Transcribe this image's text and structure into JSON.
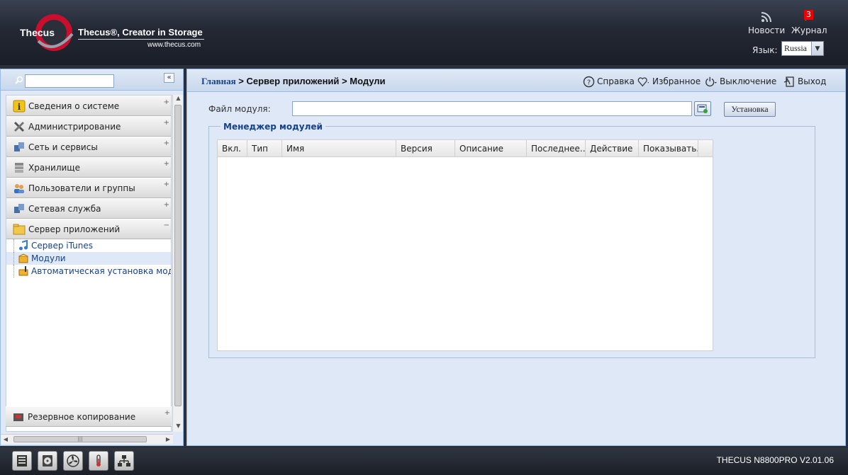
{
  "header": {
    "brand_tagline": "Thecus®, Creator in Storage",
    "brand_url": "www.thecus.com",
    "logo_text": "Thecus",
    "news_label": "Новости",
    "journal_label": "Журнал",
    "journal_badge": "3",
    "language_label": "Язык:",
    "language_value": "Russia"
  },
  "sidebar": {
    "collapse_glyph": "«",
    "items": [
      {
        "label": "Сведения о системе",
        "icon": "info-icon"
      },
      {
        "label": "Администрирование",
        "icon": "tools-icon"
      },
      {
        "label": "Сеть и сервисы",
        "icon": "network-icon"
      },
      {
        "label": "Хранилище",
        "icon": "storage-icon"
      },
      {
        "label": "Пользователи и группы",
        "icon": "users-icon"
      },
      {
        "label": "Сетевая служба",
        "icon": "network-service-icon"
      },
      {
        "label": "Сервер приложений",
        "icon": "app-server-icon"
      }
    ],
    "subitems": [
      {
        "label": "Сервер iTunes",
        "icon": "itunes-icon"
      },
      {
        "label": "Модули",
        "icon": "module-icon"
      },
      {
        "label": "Автоматическая установка модуле",
        "icon": "auto-install-icon"
      }
    ],
    "bottom_item": "Резервное копирование"
  },
  "breadcrumb": {
    "home": "Главная",
    "sep1": " > ",
    "section": "Сервер приложений",
    "sep2": " > ",
    "current": "Модули"
  },
  "toolbar": {
    "help": "Справка",
    "favorites": "Избранное",
    "shutdown": "Выключение",
    "logout": "Выход"
  },
  "module_form": {
    "file_label": "Файл модуля:",
    "file_value": "",
    "install_label": "Установка"
  },
  "module_manager": {
    "title": "Менеджер модулей",
    "columns": [
      "Вкл.",
      "Тип",
      "Имя",
      "Версия",
      "Описание",
      "Последнее...",
      "Действие",
      "Показывать..."
    ]
  },
  "footer": {
    "version": "THECUS N8800PRO V2.01.06"
  }
}
